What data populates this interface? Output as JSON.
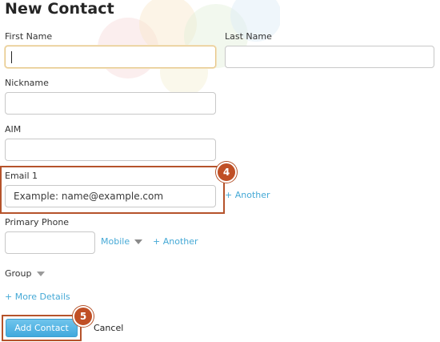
{
  "form": {
    "title": "New Contact",
    "first_name": {
      "label": "First Name",
      "value": "",
      "placeholder": ""
    },
    "last_name": {
      "label": "Last Name",
      "value": "",
      "placeholder": ""
    },
    "nickname": {
      "label": "Nickname",
      "value": "",
      "placeholder": ""
    },
    "aim": {
      "label": "AIM",
      "value": "",
      "placeholder": ""
    },
    "email": {
      "label": "Email 1",
      "placeholder": "Example: name@example.com",
      "another_label": "+ Another"
    },
    "phone": {
      "label": "Primary Phone",
      "value": "",
      "type_selected": "Mobile",
      "another_label": "+ Another"
    },
    "group": {
      "label": "Group"
    },
    "more_details_label": "+ More Details",
    "submit_label": "Add Contact",
    "cancel_label": "Cancel"
  },
  "annotations": {
    "step_email": "4",
    "step_submit": "5",
    "highlight_color": "#b5532b"
  },
  "colors": {
    "link": "#45a9d6",
    "button": "#41a9dd",
    "focus_border": "#e6c789"
  }
}
